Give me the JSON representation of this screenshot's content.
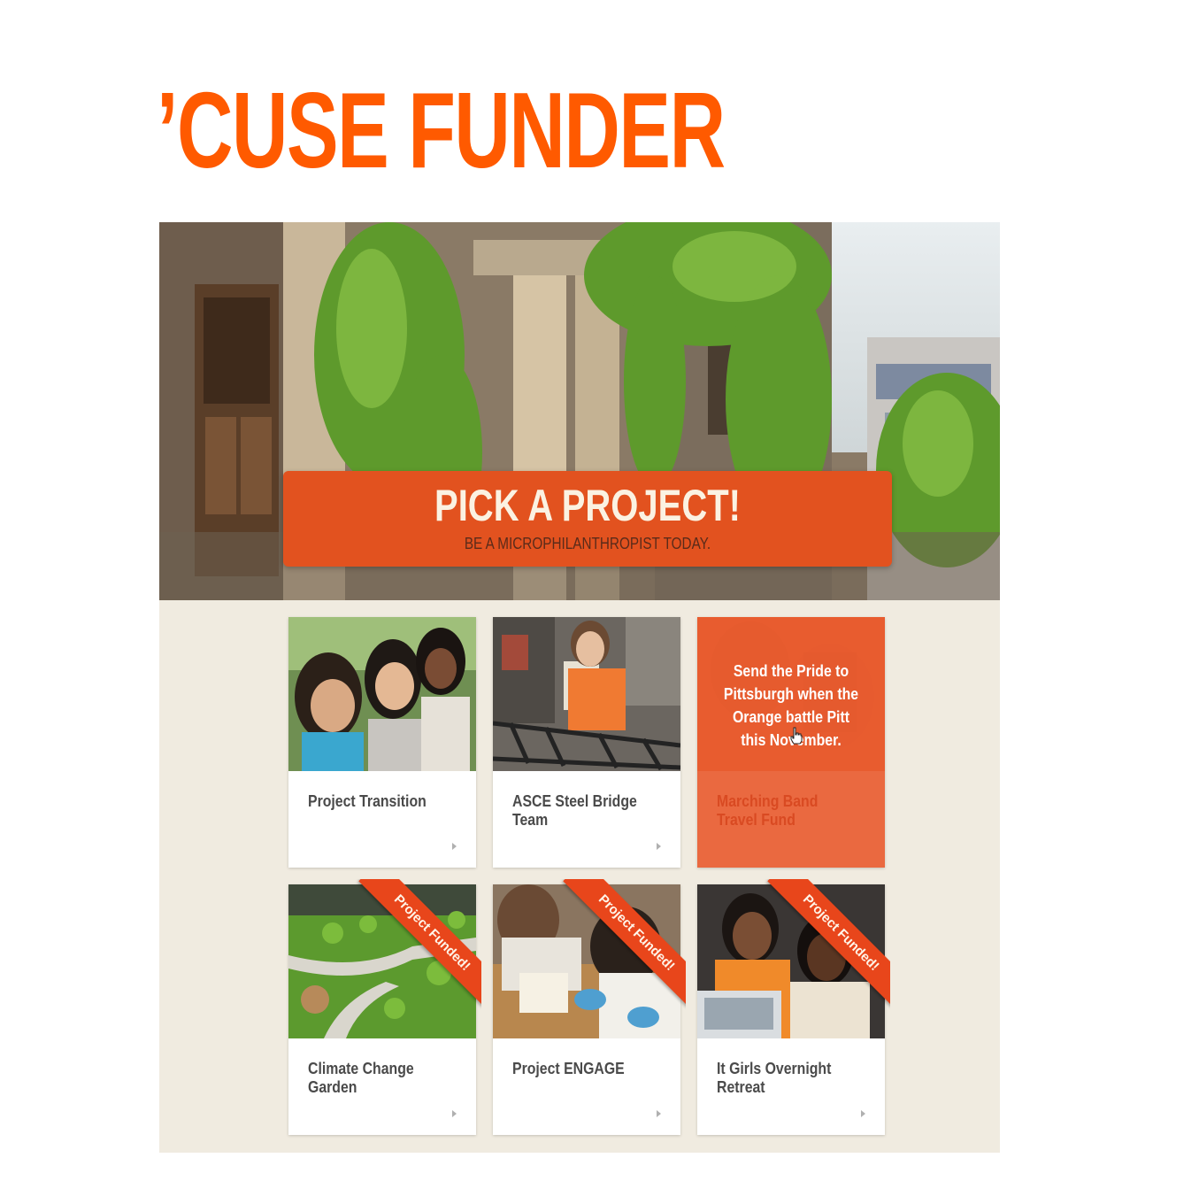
{
  "site": {
    "title": "’CUSE FUNDER"
  },
  "hero": {
    "headline": "PICK A PROJECT!",
    "subheadline": "BE A MICROPHILANTHROPIST TODAY."
  },
  "projects": [
    {
      "title": "Project Transition",
      "funded": false,
      "photo": "students-smiling-photo"
    },
    {
      "title": "ASCE Steel Bridge Team",
      "funded": false,
      "photo": "steel-bridge-photo"
    },
    {
      "title": "Marching Band Travel Fund",
      "funded": false,
      "hovered": true,
      "description": "Send the Pride to Pittsburgh when the Orange battle Pitt this November.",
      "photo": "marching-band-photo"
    },
    {
      "title": "Climate Change Garden",
      "funded": true,
      "photo": "campus-garden-photo"
    },
    {
      "title": "Project ENGAGE",
      "funded": true,
      "photo": "lab-students-photo"
    },
    {
      "title": "It Girls Overnight Retreat",
      "funded": true,
      "photo": "computer-lab-photo"
    }
  ],
  "badges": {
    "funded_label": "Project Funded!"
  },
  "icons": {
    "card_arrow": "chevron-right-icon",
    "cursor": "hand-pointer-icon"
  },
  "colors": {
    "brand_orange": "#ff5a00",
    "banner": "#e2521f",
    "ribbon": "#e8461b",
    "panel_bg": "#f0ebe0"
  }
}
